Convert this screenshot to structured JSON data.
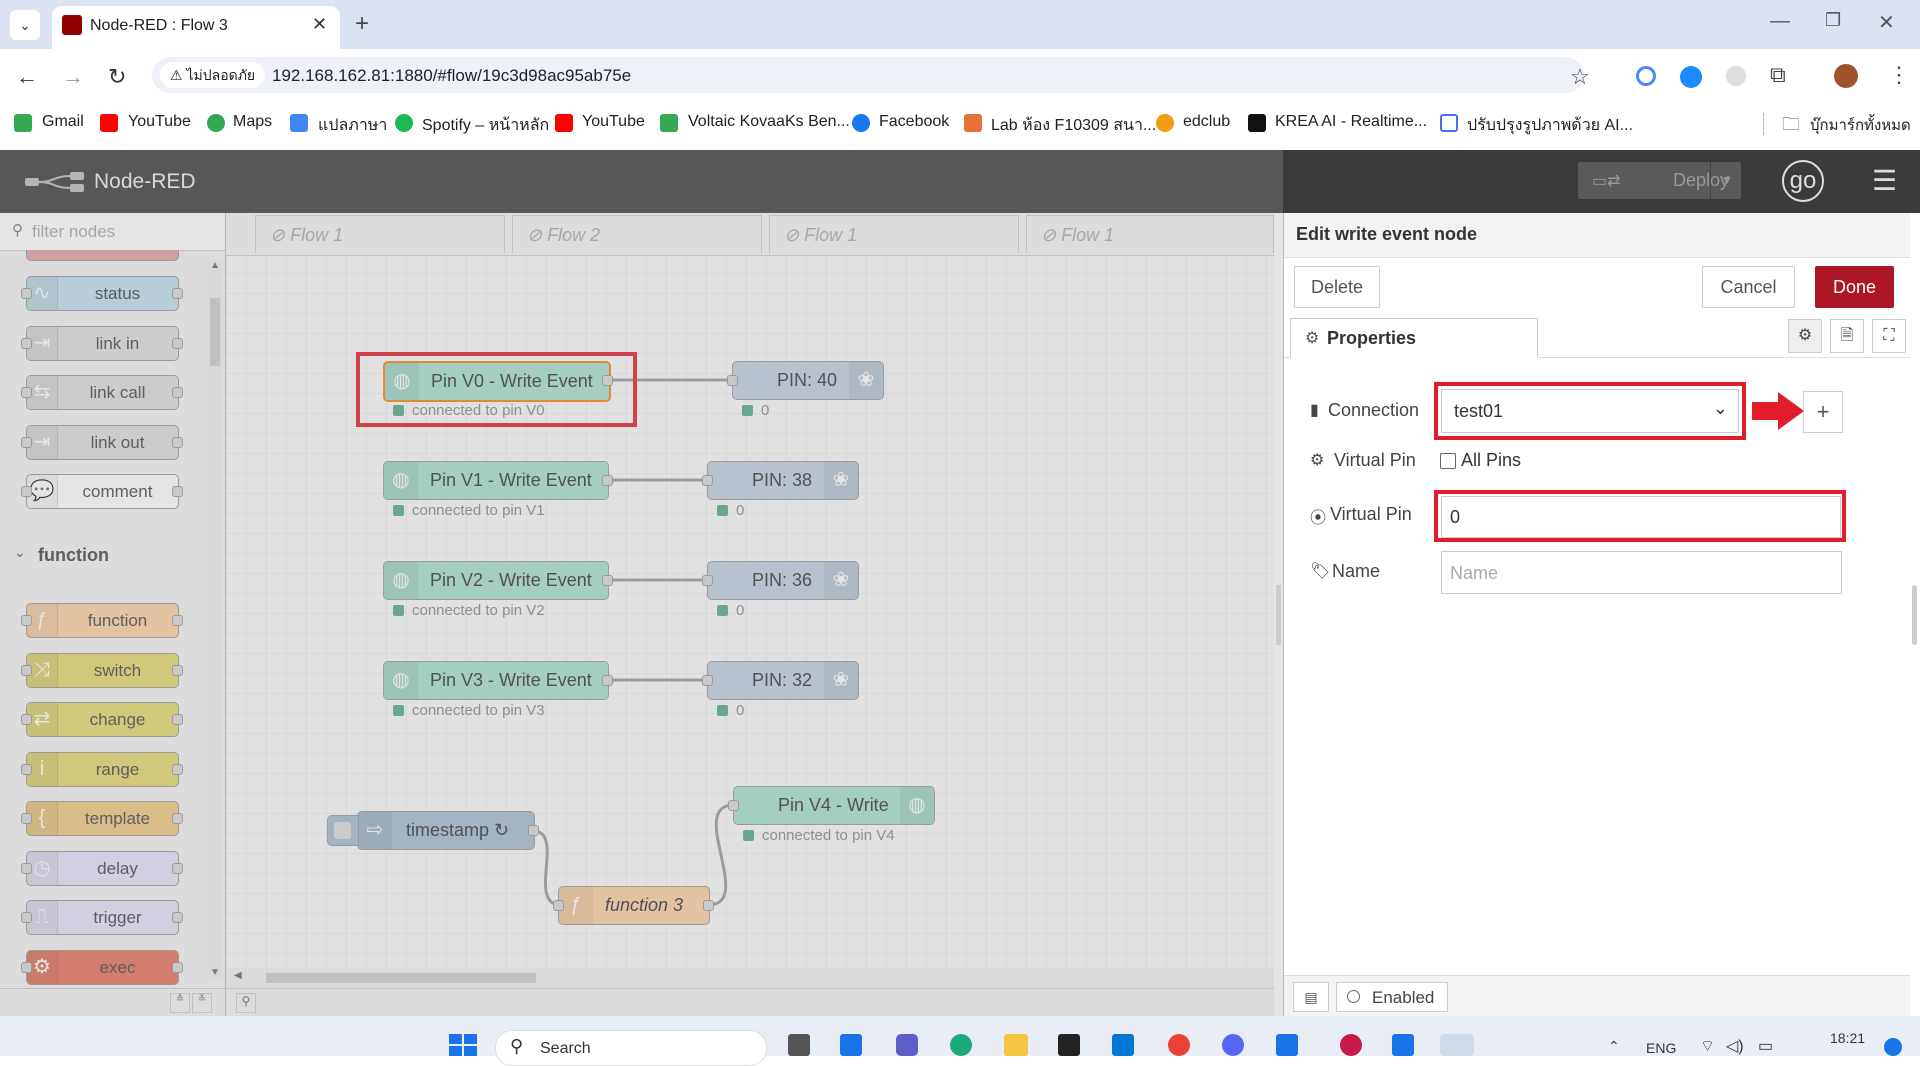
{
  "browser": {
    "tab_title": "Node-RED : Flow 3",
    "security_label": "ไม่ปลอดภัย",
    "url": "192.168.162.81:1880/#flow/19c3d98ac95ab75e",
    "bookmarks": [
      "Gmail",
      "YouTube",
      "Maps",
      "แปลภาษา",
      "Spotify – หน้าหลัก",
      "YouTube",
      "Voltaic KovaaKs Ben...",
      "Facebook",
      "Lab ห้อง F10309 สนา...",
      "edclub",
      "KREA AI - Realtime...",
      "ปรับปรุงรูปภาพด้วย AI..."
    ],
    "bookmarks_folder": "บุ๊กมาร์กทั้งหมด"
  },
  "nodered": {
    "app_title": "Node-RED",
    "deploy_label": "Deploy",
    "user_initials": "go"
  },
  "palette": {
    "filter_placeholder": "filter nodes",
    "nodes_top": [
      {
        "label": "status",
        "color": "#c0deed",
        "icon": "∿"
      },
      {
        "label": "link in",
        "color": "#dddddd",
        "icon": "⇥"
      },
      {
        "label": "link call",
        "color": "#dddddd",
        "icon": "⇆"
      },
      {
        "label": "link out",
        "color": "#dddddd",
        "icon": "⇥"
      },
      {
        "label": "comment",
        "color": "#ffffff",
        "icon": "💬"
      }
    ],
    "category": "function",
    "nodes_function": [
      {
        "label": "function",
        "color": "#fdd0a2",
        "icon": "ƒ"
      },
      {
        "label": "switch",
        "color": "#e2d96e",
        "icon": "⤨"
      },
      {
        "label": "change",
        "color": "#e2d96e",
        "icon": "⇄"
      },
      {
        "label": "range",
        "color": "#e2d96e",
        "icon": "i"
      },
      {
        "label": "template",
        "color": "#f0c880",
        "icon": "{"
      },
      {
        "label": "delay",
        "color": "#e6e0f8",
        "icon": "◷"
      },
      {
        "label": "trigger",
        "color": "#e6e0f8",
        "icon": "⎍"
      },
      {
        "label": "exec",
        "color": "#e8705a",
        "icon": "⚙"
      }
    ]
  },
  "workspace": {
    "tabs": [
      "Flow 1",
      "Flow 2",
      "Flow 1",
      "Flow 1"
    ],
    "write_nodes": [
      {
        "label": "Pin V0 - Write Event",
        "status": "connected to pin V0",
        "pin": "PIN: 40",
        "pin_status": "0"
      },
      {
        "label": "Pin V1 - Write Event",
        "status": "connected to pin V1",
        "pin": "PIN: 38",
        "pin_status": "0"
      },
      {
        "label": "Pin V2 - Write Event",
        "status": "connected to pin V2",
        "pin": "PIN: 36",
        "pin_status": "0"
      },
      {
        "label": "Pin V3 - Write Event",
        "status": "connected to pin V3",
        "pin": "PIN: 32",
        "pin_status": "0"
      }
    ],
    "timestamp_label": "timestamp ↻",
    "function_label": "function 3",
    "write_v4_label": "Pin V4 - Write",
    "write_v4_status": "connected to pin V4"
  },
  "editor": {
    "title": "Edit write event node",
    "delete_label": "Delete",
    "cancel_label": "Cancel",
    "done_label": "Done",
    "properties_tab": "Properties",
    "connection_label": "Connection",
    "connection_value": "test01",
    "virtual_pin_label": "Virtual Pin",
    "all_pins_label": "All Pins",
    "virtual_pin_label_2": "Virtual Pin",
    "virtual_pin_value": "0",
    "name_label": "Name",
    "name_placeholder": "Name",
    "enabled_label": "Enabled",
    "accent_color": "#ad1625"
  },
  "taskbar": {
    "search_label": "Search",
    "language": "ENG",
    "time": "18:21"
  }
}
